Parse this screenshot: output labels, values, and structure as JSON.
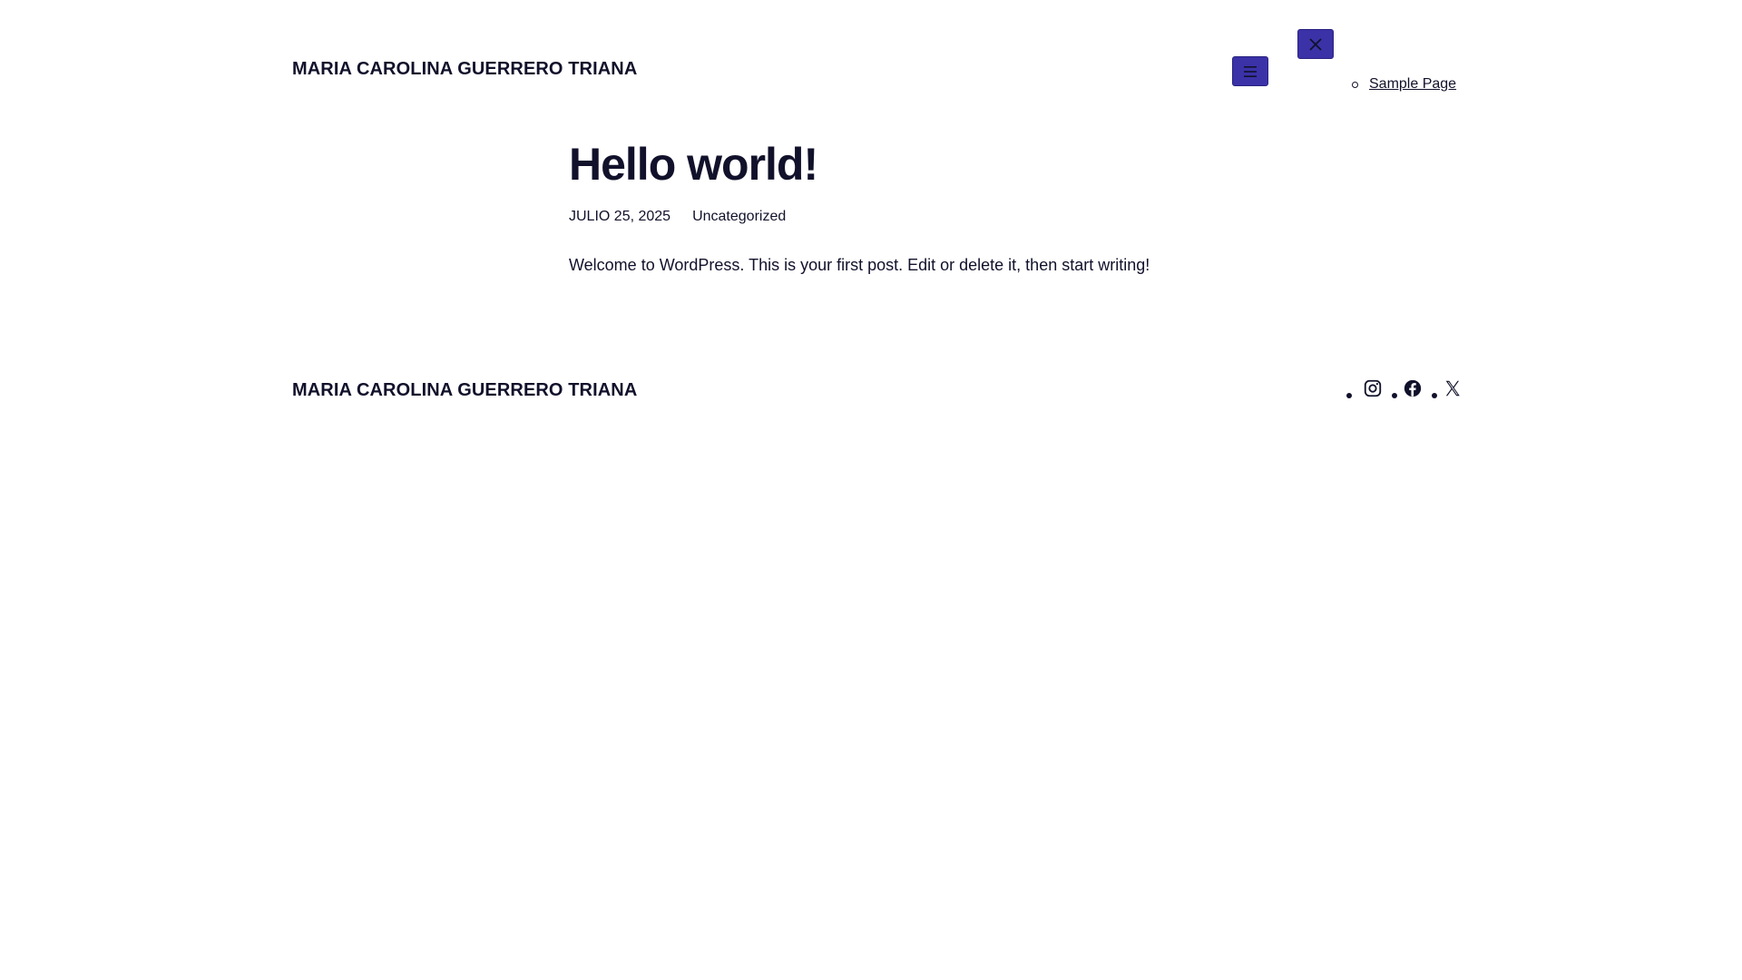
{
  "header": {
    "site_title": "MARIA CAROLINA GUERRERO TRIANA",
    "menu_icon": "hamburger-icon",
    "close_icon": "close-icon",
    "nav": [
      {
        "label": "Sample Page"
      }
    ]
  },
  "post": {
    "title": "Hello world!",
    "date": "JULIO 25, 2025",
    "category": "Uncategorized",
    "content": "Welcome to WordPress. This is your first post. Edit or delete it, then start writing!"
  },
  "footer": {
    "site_title": "MARIA CAROLINA GUERRERO TRIANA",
    "social": [
      {
        "icon": "instagram-icon"
      },
      {
        "icon": "facebook-icon"
      },
      {
        "icon": "x-icon"
      }
    ]
  },
  "colors": {
    "button_bg": "#3b32a8",
    "text": "#11112b",
    "background": "#ffffff"
  }
}
